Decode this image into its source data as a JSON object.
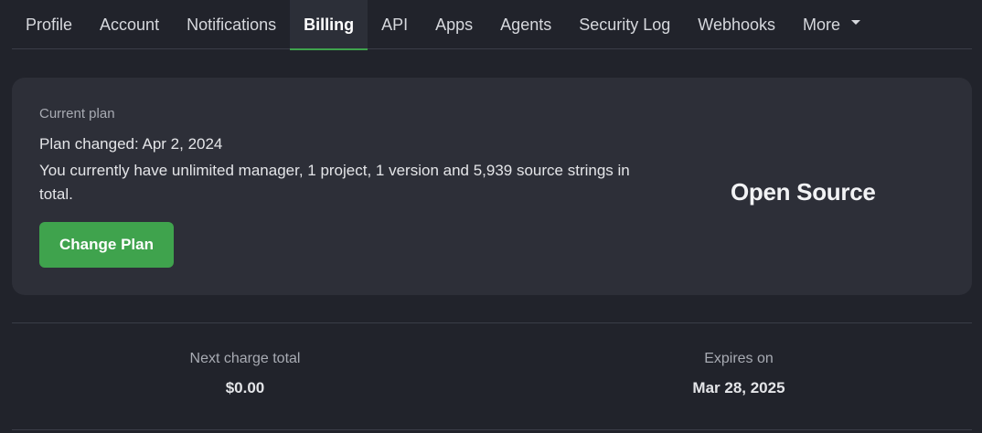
{
  "tabs": [
    {
      "label": "Profile",
      "active": false
    },
    {
      "label": "Account",
      "active": false
    },
    {
      "label": "Notifications",
      "active": false
    },
    {
      "label": "Billing",
      "active": true
    },
    {
      "label": "API",
      "active": false
    },
    {
      "label": "Apps",
      "active": false
    },
    {
      "label": "Agents",
      "active": false
    },
    {
      "label": "Security Log",
      "active": false
    },
    {
      "label": "Webhooks",
      "active": false
    },
    {
      "label": "More",
      "active": false
    }
  ],
  "plan": {
    "label": "Current plan",
    "changed": "Plan changed: Apr 2, 2024",
    "description": "You currently have unlimited manager, 1 project, 1 version and 5,939 source strings in total.",
    "button_label": "Change Plan",
    "name": "Open Source"
  },
  "summary": {
    "next_charge_label": "Next charge total",
    "next_charge_value": "$0.00",
    "expires_label": "Expires on",
    "expires_value": "Mar 28, 2025"
  },
  "colors": {
    "background": "#21232b",
    "card": "#2d2f38",
    "accent": "#3fa34d"
  }
}
